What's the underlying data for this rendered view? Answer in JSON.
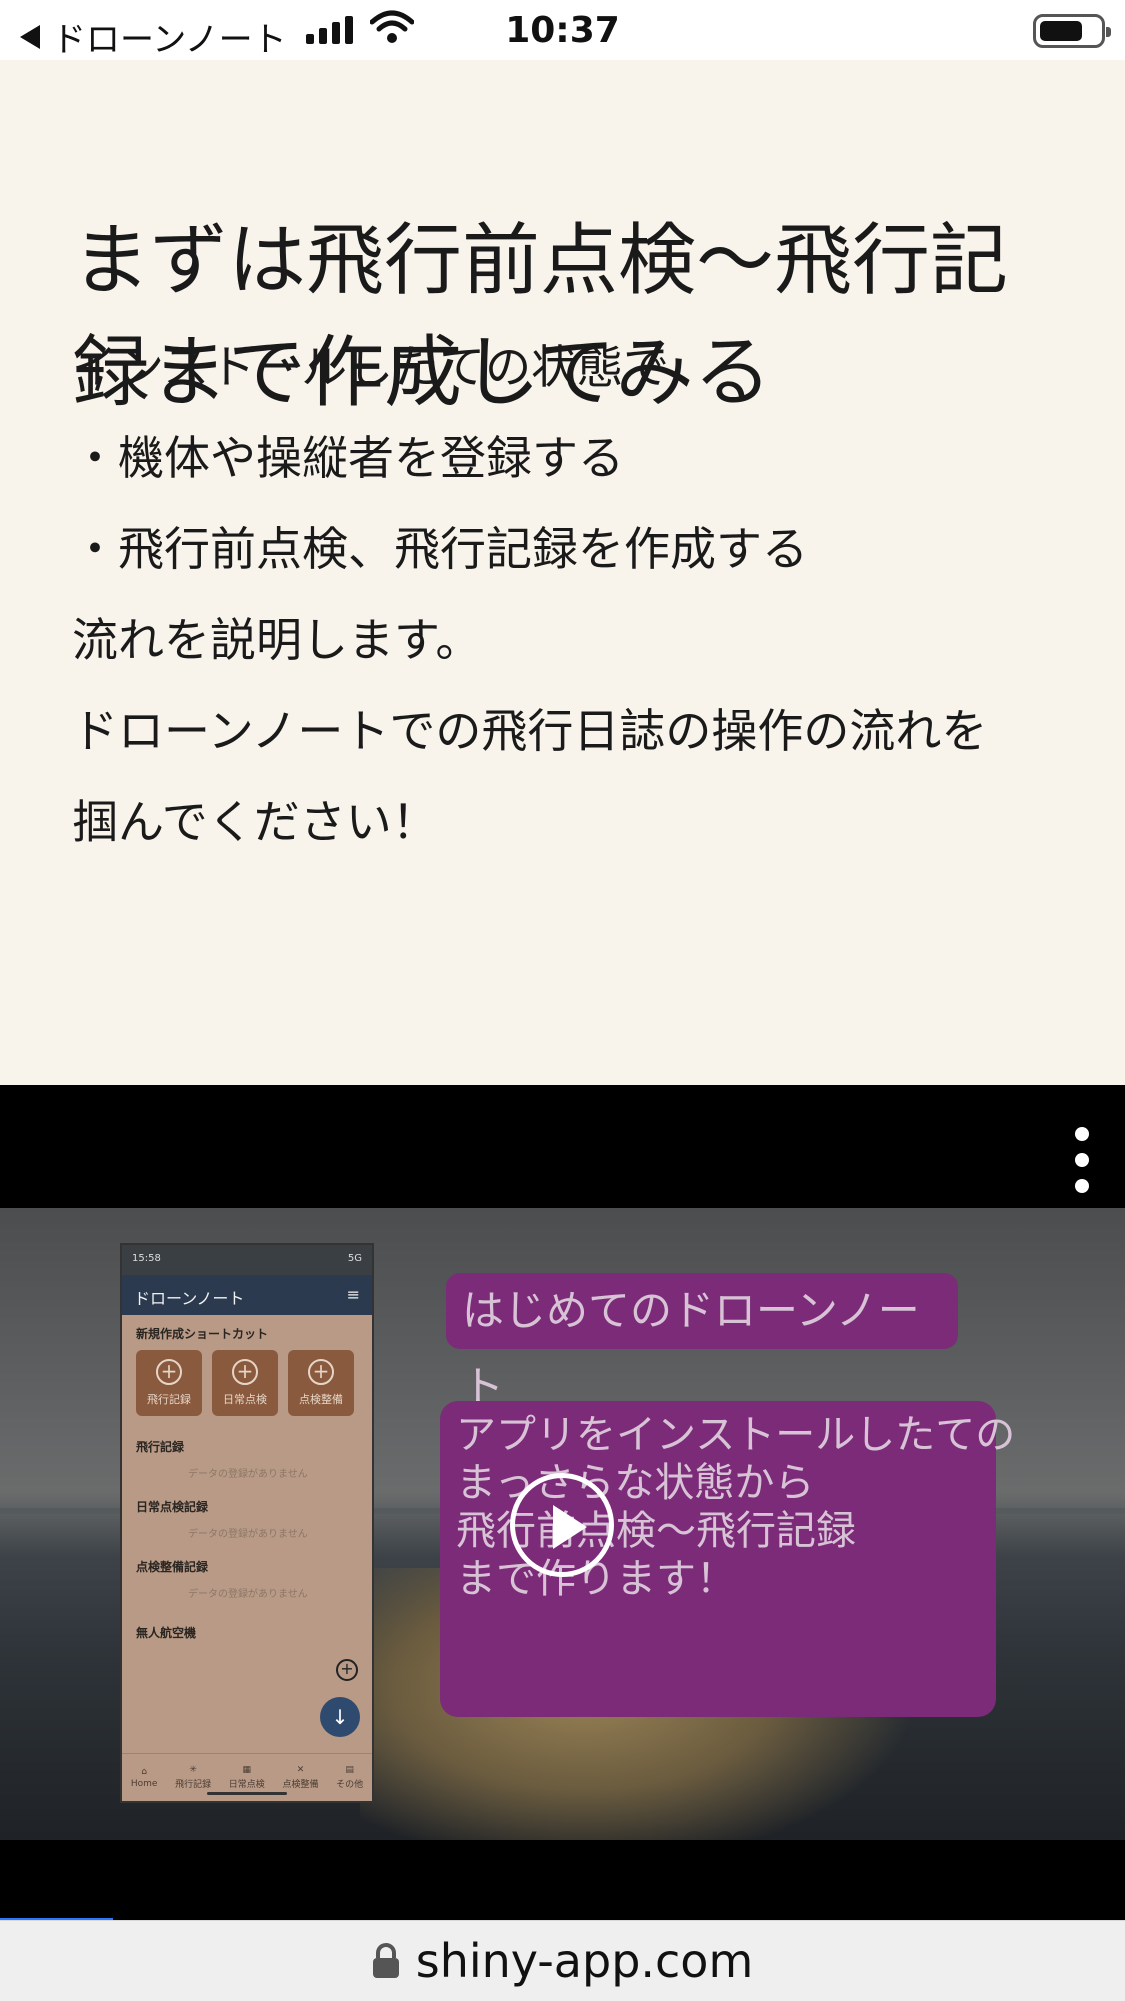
{
  "status_bar": {
    "back_label": "ドローンノート",
    "time": "10:37"
  },
  "article": {
    "heading": "まずは飛行前点検〜飛行記録まで作成してみる",
    "paragraphs": [
      "インストールしたての状態で",
      "・機体や操縦者を登録する",
      "・飛行前点検、飛行記録を作成する",
      "流れを説明します。",
      "ドローンノートでの飛行日誌の操作の流れを",
      "掴んでください！"
    ]
  },
  "video": {
    "title_overlay": "はじめてのドローンノート",
    "description_lines": [
      "アプリをインストールしたての",
      "まっさらな状態から",
      "",
      "飛行前点検〜飛行記録",
      "",
      "まで作ります！"
    ],
    "progress_percent": 10,
    "phone": {
      "status_time": "15:58",
      "status_network": "5G",
      "header_title": "ドローンノート",
      "shortcut_section": "新規作成ショートカット",
      "shortcuts": [
        "飛行記録",
        "日常点検",
        "点検整備"
      ],
      "sections": [
        {
          "title": "飛行記録",
          "empty": "データの登録がありません"
        },
        {
          "title": "日常点検記録",
          "empty": "データの登録がありません"
        },
        {
          "title": "点検整備記録",
          "empty": "データの登録がありません"
        }
      ],
      "aircraft_section": "無人航空機",
      "nav": [
        "Home",
        "飛行記録",
        "日常点検",
        "点検整備",
        "その他"
      ]
    }
  },
  "url_bar": {
    "domain": "shiny-app.com"
  }
}
